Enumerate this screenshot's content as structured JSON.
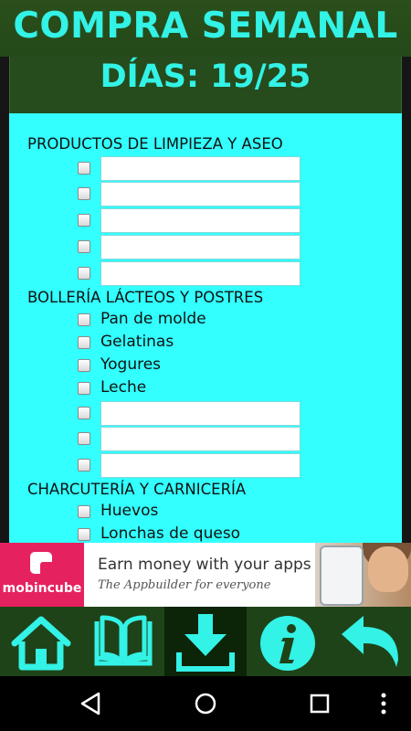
{
  "header": {
    "title": "COMPRA SEMANAL",
    "days": "DÍAS: 19/25"
  },
  "sections": [
    {
      "title": "PRODUCTOS DE LIMPIEZA Y ASEO",
      "items": [
        {
          "label": "",
          "type": "input"
        },
        {
          "label": "",
          "type": "input"
        },
        {
          "label": "",
          "type": "input"
        },
        {
          "label": "",
          "type": "input"
        },
        {
          "label": "",
          "type": "input"
        }
      ]
    },
    {
      "title": "BOLLERÍA LÁCTEOS Y POSTRES",
      "items": [
        {
          "label": "Pan de molde",
          "type": "text"
        },
        {
          "label": "Gelatinas",
          "type": "text"
        },
        {
          "label": "Yogures",
          "type": "text"
        },
        {
          "label": "Leche",
          "type": "text"
        },
        {
          "label": "",
          "type": "input"
        },
        {
          "label": "",
          "type": "input"
        },
        {
          "label": "",
          "type": "input"
        }
      ]
    },
    {
      "title": "CHARCUTERÍA Y CARNICERÍA",
      "items": [
        {
          "label": "Huevos",
          "type": "text"
        },
        {
          "label": "Lonchas de queso",
          "type": "text"
        }
      ]
    }
  ],
  "ad": {
    "brand": "mobincube",
    "headline": "Earn money with your apps",
    "subline": "The Appbuilder for everyone"
  },
  "toolbar": {
    "icons": [
      "home-icon",
      "book-icon",
      "download-icon",
      "info-icon",
      "back-arrow-icon"
    ],
    "color": "#33f2e6",
    "background": "#1f4318"
  },
  "navbar": {
    "icons": [
      "nav-back-icon",
      "nav-home-icon",
      "nav-recents-icon",
      "nav-menu-icon"
    ]
  }
}
